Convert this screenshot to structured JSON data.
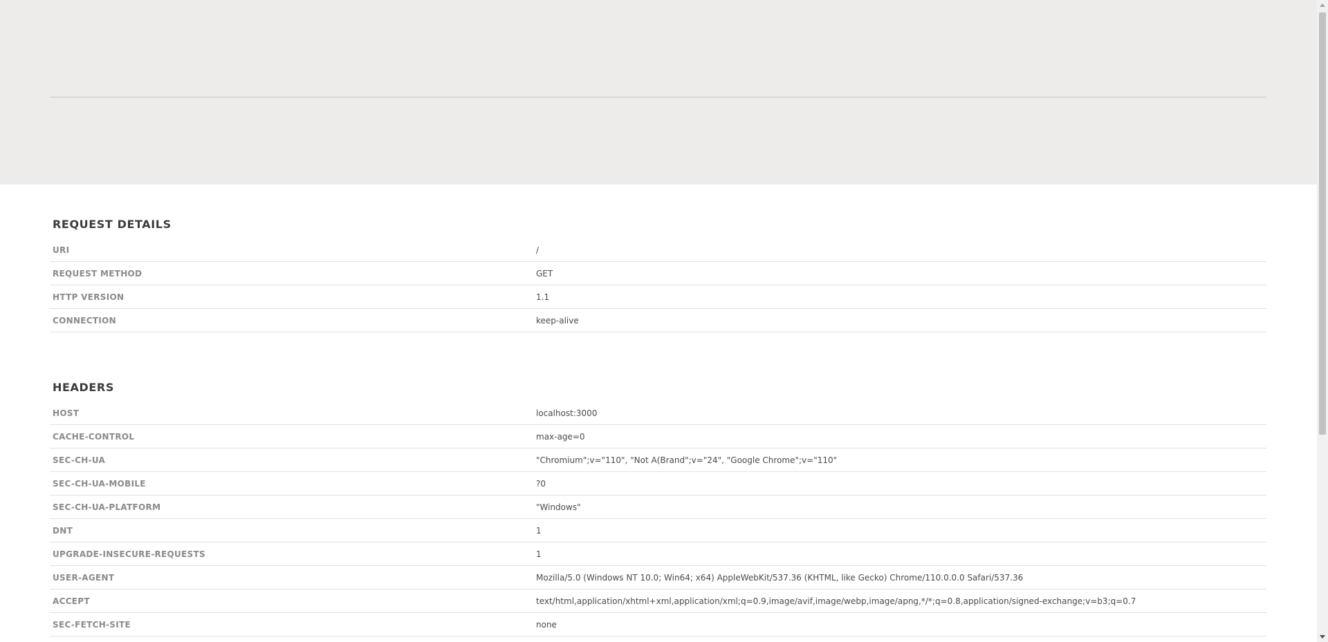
{
  "request_details": {
    "title": "REQUEST DETAILS",
    "rows": [
      {
        "key": "URI",
        "value": "/"
      },
      {
        "key": "REQUEST METHOD",
        "value": "GET"
      },
      {
        "key": "HTTP VERSION",
        "value": "1.1"
      },
      {
        "key": "CONNECTION",
        "value": "keep-alive"
      }
    ]
  },
  "headers": {
    "title": "HEADERS",
    "rows": [
      {
        "key": "HOST",
        "value": "localhost:3000"
      },
      {
        "key": "CACHE-CONTROL",
        "value": "max-age=0"
      },
      {
        "key": "SEC-CH-UA",
        "value": "\"Chromium\";v=\"110\", \"Not A(Brand\";v=\"24\", \"Google Chrome\";v=\"110\""
      },
      {
        "key": "SEC-CH-UA-MOBILE",
        "value": "?0"
      },
      {
        "key": "SEC-CH-UA-PLATFORM",
        "value": "\"Windows\""
      },
      {
        "key": "DNT",
        "value": "1"
      },
      {
        "key": "UPGRADE-INSECURE-REQUESTS",
        "value": "1"
      },
      {
        "key": "USER-AGENT",
        "value": "Mozilla/5.0 (Windows NT 10.0; Win64; x64) AppleWebKit/537.36 (KHTML, like Gecko) Chrome/110.0.0.0 Safari/537.36"
      },
      {
        "key": "ACCEPT",
        "value": "text/html,application/xhtml+xml,application/xml;q=0.9,image/avif,image/webp,image/apng,*/*;q=0.8,application/signed-exchange;v=b3;q=0.7"
      },
      {
        "key": "SEC-FETCH-SITE",
        "value": "none"
      }
    ]
  },
  "colors": {
    "hero_background": "#edecea",
    "divider": "#e2e1df",
    "key_text": "#8a8a8a",
    "value_text": "#4a4a4a"
  }
}
